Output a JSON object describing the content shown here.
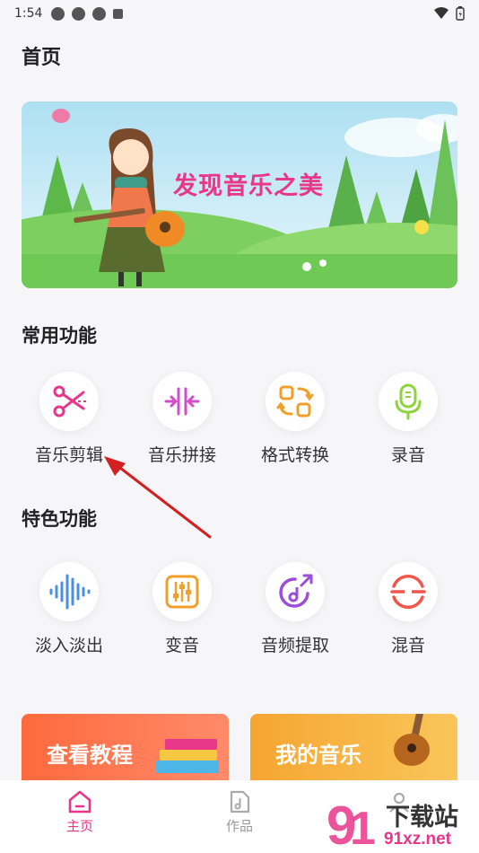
{
  "status_bar": {
    "time": "1:54"
  },
  "page_title": "首页",
  "banner": {
    "text": "发现音乐之美"
  },
  "common_section": {
    "title": "常用功能",
    "items": [
      {
        "label": "音乐剪辑",
        "icon": "scissors-icon"
      },
      {
        "label": "音乐拼接",
        "icon": "merge-icon"
      },
      {
        "label": "格式转换",
        "icon": "convert-icon"
      },
      {
        "label": "录音",
        "icon": "microphone-icon"
      }
    ]
  },
  "feature_section": {
    "title": "特色功能",
    "items": [
      {
        "label": "淡入淡出",
        "icon": "waveform-icon"
      },
      {
        "label": "变音",
        "icon": "equalizer-icon"
      },
      {
        "label": "音频提取",
        "icon": "music-extract-icon"
      },
      {
        "label": "混音",
        "icon": "mix-icon"
      }
    ]
  },
  "promos": [
    {
      "label": "查看教程"
    },
    {
      "label": "我的音乐"
    }
  ],
  "tabbar": {
    "items": [
      {
        "label": "主页",
        "active": true
      },
      {
        "label": "作品",
        "active": false
      },
      {
        "label": "",
        "active": false
      }
    ]
  },
  "watermark": {
    "text1": "下载站",
    "text2": "91xz.net"
  },
  "colors": {
    "accent": "#e8368a",
    "background": "#f6f6f8"
  }
}
